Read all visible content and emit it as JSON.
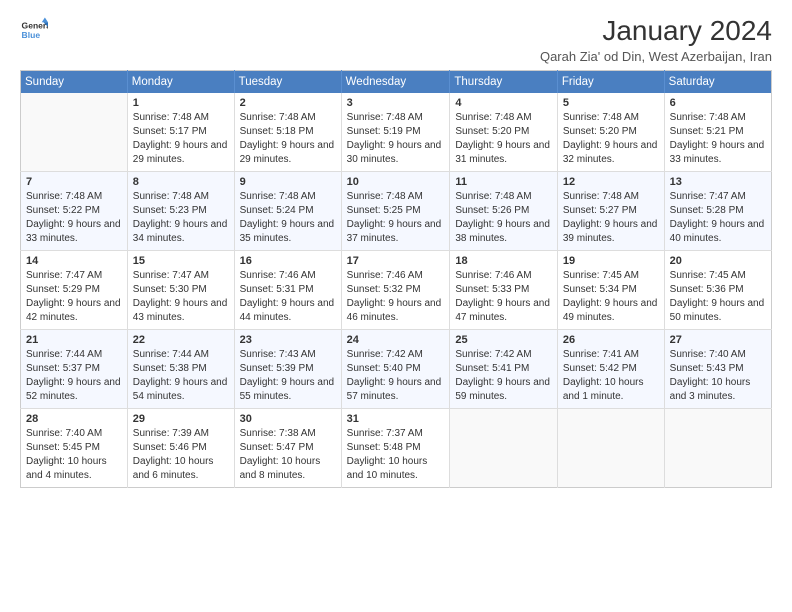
{
  "logo": {
    "line1": "General",
    "line2": "Blue"
  },
  "title": "January 2024",
  "subtitle": "Qarah Zia' od Din, West Azerbaijan, Iran",
  "days_of_week": [
    "Sunday",
    "Monday",
    "Tuesday",
    "Wednesday",
    "Thursday",
    "Friday",
    "Saturday"
  ],
  "weeks": [
    [
      {
        "day": "",
        "sunrise": "",
        "sunset": "",
        "daylight": ""
      },
      {
        "day": "1",
        "sunrise": "Sunrise: 7:48 AM",
        "sunset": "Sunset: 5:17 PM",
        "daylight": "Daylight: 9 hours and 29 minutes."
      },
      {
        "day": "2",
        "sunrise": "Sunrise: 7:48 AM",
        "sunset": "Sunset: 5:18 PM",
        "daylight": "Daylight: 9 hours and 29 minutes."
      },
      {
        "day": "3",
        "sunrise": "Sunrise: 7:48 AM",
        "sunset": "Sunset: 5:19 PM",
        "daylight": "Daylight: 9 hours and 30 minutes."
      },
      {
        "day": "4",
        "sunrise": "Sunrise: 7:48 AM",
        "sunset": "Sunset: 5:20 PM",
        "daylight": "Daylight: 9 hours and 31 minutes."
      },
      {
        "day": "5",
        "sunrise": "Sunrise: 7:48 AM",
        "sunset": "Sunset: 5:20 PM",
        "daylight": "Daylight: 9 hours and 32 minutes."
      },
      {
        "day": "6",
        "sunrise": "Sunrise: 7:48 AM",
        "sunset": "Sunset: 5:21 PM",
        "daylight": "Daylight: 9 hours and 33 minutes."
      }
    ],
    [
      {
        "day": "7",
        "sunrise": "Sunrise: 7:48 AM",
        "sunset": "Sunset: 5:22 PM",
        "daylight": "Daylight: 9 hours and 33 minutes."
      },
      {
        "day": "8",
        "sunrise": "Sunrise: 7:48 AM",
        "sunset": "Sunset: 5:23 PM",
        "daylight": "Daylight: 9 hours and 34 minutes."
      },
      {
        "day": "9",
        "sunrise": "Sunrise: 7:48 AM",
        "sunset": "Sunset: 5:24 PM",
        "daylight": "Daylight: 9 hours and 35 minutes."
      },
      {
        "day": "10",
        "sunrise": "Sunrise: 7:48 AM",
        "sunset": "Sunset: 5:25 PM",
        "daylight": "Daylight: 9 hours and 37 minutes."
      },
      {
        "day": "11",
        "sunrise": "Sunrise: 7:48 AM",
        "sunset": "Sunset: 5:26 PM",
        "daylight": "Daylight: 9 hours and 38 minutes."
      },
      {
        "day": "12",
        "sunrise": "Sunrise: 7:48 AM",
        "sunset": "Sunset: 5:27 PM",
        "daylight": "Daylight: 9 hours and 39 minutes."
      },
      {
        "day": "13",
        "sunrise": "Sunrise: 7:47 AM",
        "sunset": "Sunset: 5:28 PM",
        "daylight": "Daylight: 9 hours and 40 minutes."
      }
    ],
    [
      {
        "day": "14",
        "sunrise": "Sunrise: 7:47 AM",
        "sunset": "Sunset: 5:29 PM",
        "daylight": "Daylight: 9 hours and 42 minutes."
      },
      {
        "day": "15",
        "sunrise": "Sunrise: 7:47 AM",
        "sunset": "Sunset: 5:30 PM",
        "daylight": "Daylight: 9 hours and 43 minutes."
      },
      {
        "day": "16",
        "sunrise": "Sunrise: 7:46 AM",
        "sunset": "Sunset: 5:31 PM",
        "daylight": "Daylight: 9 hours and 44 minutes."
      },
      {
        "day": "17",
        "sunrise": "Sunrise: 7:46 AM",
        "sunset": "Sunset: 5:32 PM",
        "daylight": "Daylight: 9 hours and 46 minutes."
      },
      {
        "day": "18",
        "sunrise": "Sunrise: 7:46 AM",
        "sunset": "Sunset: 5:33 PM",
        "daylight": "Daylight: 9 hours and 47 minutes."
      },
      {
        "day": "19",
        "sunrise": "Sunrise: 7:45 AM",
        "sunset": "Sunset: 5:34 PM",
        "daylight": "Daylight: 9 hours and 49 minutes."
      },
      {
        "day": "20",
        "sunrise": "Sunrise: 7:45 AM",
        "sunset": "Sunset: 5:36 PM",
        "daylight": "Daylight: 9 hours and 50 minutes."
      }
    ],
    [
      {
        "day": "21",
        "sunrise": "Sunrise: 7:44 AM",
        "sunset": "Sunset: 5:37 PM",
        "daylight": "Daylight: 9 hours and 52 minutes."
      },
      {
        "day": "22",
        "sunrise": "Sunrise: 7:44 AM",
        "sunset": "Sunset: 5:38 PM",
        "daylight": "Daylight: 9 hours and 54 minutes."
      },
      {
        "day": "23",
        "sunrise": "Sunrise: 7:43 AM",
        "sunset": "Sunset: 5:39 PM",
        "daylight": "Daylight: 9 hours and 55 minutes."
      },
      {
        "day": "24",
        "sunrise": "Sunrise: 7:42 AM",
        "sunset": "Sunset: 5:40 PM",
        "daylight": "Daylight: 9 hours and 57 minutes."
      },
      {
        "day": "25",
        "sunrise": "Sunrise: 7:42 AM",
        "sunset": "Sunset: 5:41 PM",
        "daylight": "Daylight: 9 hours and 59 minutes."
      },
      {
        "day": "26",
        "sunrise": "Sunrise: 7:41 AM",
        "sunset": "Sunset: 5:42 PM",
        "daylight": "Daylight: 10 hours and 1 minute."
      },
      {
        "day": "27",
        "sunrise": "Sunrise: 7:40 AM",
        "sunset": "Sunset: 5:43 PM",
        "daylight": "Daylight: 10 hours and 3 minutes."
      }
    ],
    [
      {
        "day": "28",
        "sunrise": "Sunrise: 7:40 AM",
        "sunset": "Sunset: 5:45 PM",
        "daylight": "Daylight: 10 hours and 4 minutes."
      },
      {
        "day": "29",
        "sunrise": "Sunrise: 7:39 AM",
        "sunset": "Sunset: 5:46 PM",
        "daylight": "Daylight: 10 hours and 6 minutes."
      },
      {
        "day": "30",
        "sunrise": "Sunrise: 7:38 AM",
        "sunset": "Sunset: 5:47 PM",
        "daylight": "Daylight: 10 hours and 8 minutes."
      },
      {
        "day": "31",
        "sunrise": "Sunrise: 7:37 AM",
        "sunset": "Sunset: 5:48 PM",
        "daylight": "Daylight: 10 hours and 10 minutes."
      },
      {
        "day": "",
        "sunrise": "",
        "sunset": "",
        "daylight": ""
      },
      {
        "day": "",
        "sunrise": "",
        "sunset": "",
        "daylight": ""
      },
      {
        "day": "",
        "sunrise": "",
        "sunset": "",
        "daylight": ""
      }
    ]
  ]
}
